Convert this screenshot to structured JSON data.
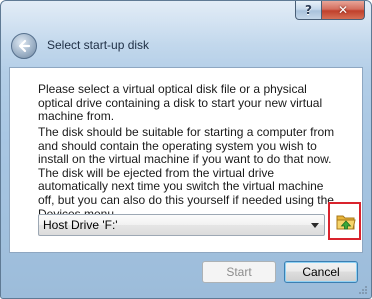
{
  "window": {
    "title": "Select start-up disk"
  },
  "caption": {
    "help_glyph": "?",
    "close_glyph": "✕"
  },
  "content": {
    "paragraph1": "Please select a virtual optical disk file or a physical optical drive containing a disk to start your new virtual machine from.",
    "paragraph2": "The disk should be suitable for starting a computer from and should contain the operating system you wish to install on the virtual machine if you want to do that now. The disk will be ejected from the virtual drive automatically next time you switch the virtual machine off, but you can also do this yourself if needed using the Devices menu."
  },
  "drive_select": {
    "selected": "Host Drive 'F:'"
  },
  "buttons": {
    "start": "Start",
    "cancel": "Cancel"
  },
  "colors": {
    "highlight": "#d9232d",
    "folder": "#e8b53a",
    "folder_arrow": "#3aa93a"
  },
  "icons": {
    "back": "back-arrow-icon",
    "folder": "folder-open-icon",
    "dropdown": "chevron-down-icon"
  }
}
